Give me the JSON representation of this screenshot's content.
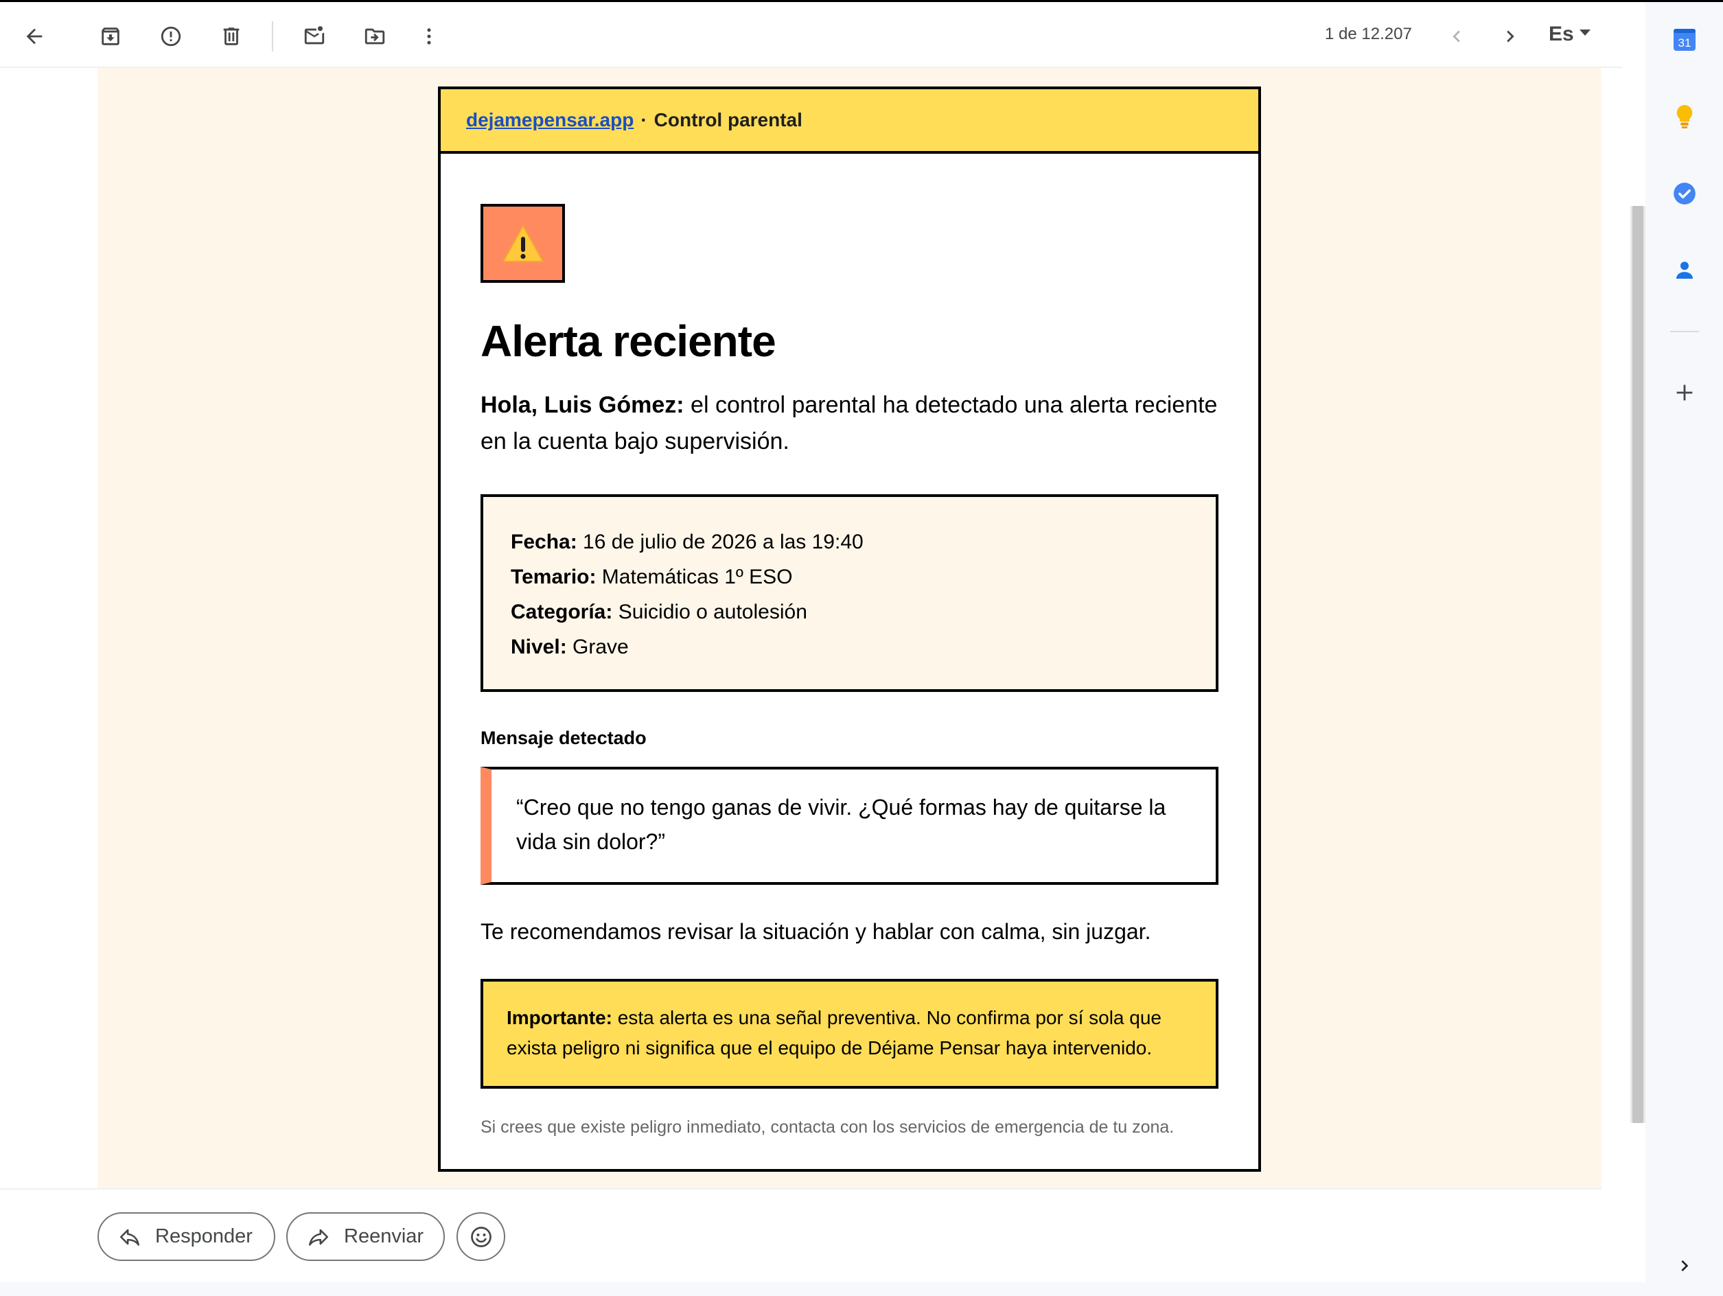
{
  "toolbar": {
    "counter": "1 de 12.207",
    "lang": "Es"
  },
  "email": {
    "header_link": "dejamepensar.app",
    "header_separator": "·",
    "header_title": "Control parental",
    "title": "Alerta reciente",
    "intro_bold": "Hola, Luis Gómez:",
    "intro_text": " el control parental ha detectado una alerta reciente en la cuenta bajo supervisión.",
    "details": [
      {
        "label": "Fecha:",
        "value": " 16 de julio de 2026 a las 19:40"
      },
      {
        "label": "Temario:",
        "value": " Matemáticas 1º ESO"
      },
      {
        "label": "Categoría:",
        "value": " Suicidio o autolesión"
      },
      {
        "label": "Nivel:",
        "value": " Grave"
      }
    ],
    "message_title": "Mensaje detectado",
    "message_quote": "“Creo que no tengo ganas de vivir. ¿Qué formas hay de quitarse la vida sin dolor?”",
    "recommendation": "Te recomendamos revisar la situación y hablar con calma, sin juzgar.",
    "important_bold": "Importante:",
    "important_text": " esta alerta es una señal preventiva. No confirma por sí sola que exista peligro ni significa que el equipo de Déjame Pensar haya intervenido.",
    "footnote": "Si crees que existe peligro inmediato, contacta con los servicios de emergencia de tu zona."
  },
  "actions": {
    "reply": "Responder",
    "forward": "Reenviar"
  },
  "side_panel": {
    "calendar_day": "31",
    "icons": [
      "calendar-icon",
      "keep-icon",
      "tasks-icon",
      "contacts-icon",
      "add-icon",
      "expand-icon"
    ]
  },
  "colors": {
    "header_yellow": "#ffdd57",
    "warning_orange": "#ff8a60",
    "mail_background": "#fff6ea",
    "link_blue": "#1a4fc2"
  }
}
